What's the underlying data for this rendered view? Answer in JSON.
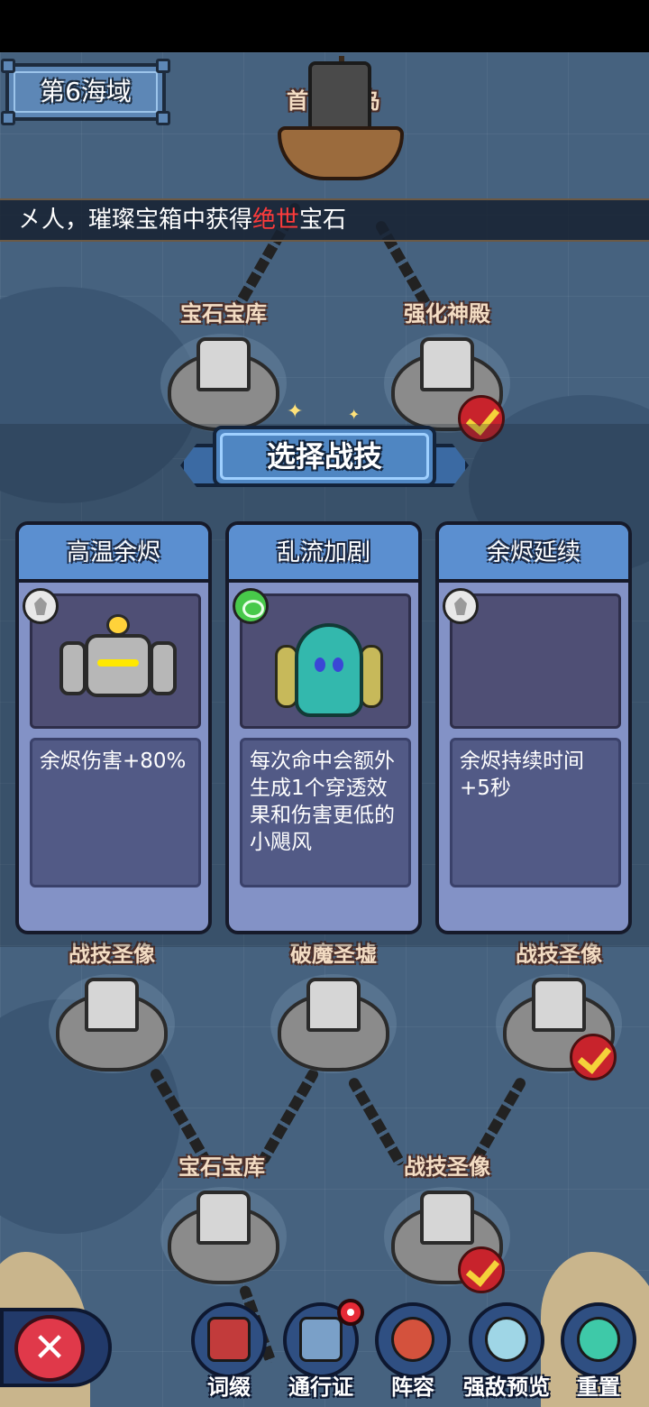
{
  "zone": {
    "label": "第6海域"
  },
  "ship": {
    "label_left": "首",
    "label_right": "岛"
  },
  "ticker": {
    "prefix": "㐅人，璀璨宝箱中获得",
    "highlight": "绝世",
    "suffix": "宝石",
    "highlight_color": "#ff3b3b"
  },
  "map_nodes": [
    {
      "label": "宝石宝库",
      "completed": false
    },
    {
      "label": "强化神殿",
      "completed": true
    },
    {
      "label": "战技圣像",
      "completed": false
    },
    {
      "label": "破魔圣墟",
      "completed": false
    },
    {
      "label": "战技圣像",
      "completed": true
    },
    {
      "label": "宝石宝库",
      "completed": false
    },
    {
      "label": "战技圣像",
      "completed": true
    }
  ],
  "modal": {
    "title": "选择战技",
    "cards": [
      {
        "name": "高温余烬",
        "icon": "crystal-element-icon",
        "description": "余烬伤害+80%"
      },
      {
        "name": "乱流加剧",
        "icon": "wind-element-icon",
        "description": "每次命中会额外生成1个穿透效果和伤害更低的小飓风"
      },
      {
        "name": "余烬延续",
        "icon": "crystal-element-icon",
        "description": "余烬持续时间+5秒"
      }
    ]
  },
  "bottom_nav": {
    "close_label": "✕",
    "items": [
      {
        "label": "词缀",
        "icon": "card-icon"
      },
      {
        "label": "通行证",
        "icon": "passport-icon",
        "notification": true
      },
      {
        "label": "阵容",
        "icon": "hero-icon"
      },
      {
        "label": "强敌预览",
        "icon": "magnifier-icon"
      },
      {
        "label": "重置",
        "icon": "reset-icon"
      }
    ]
  }
}
